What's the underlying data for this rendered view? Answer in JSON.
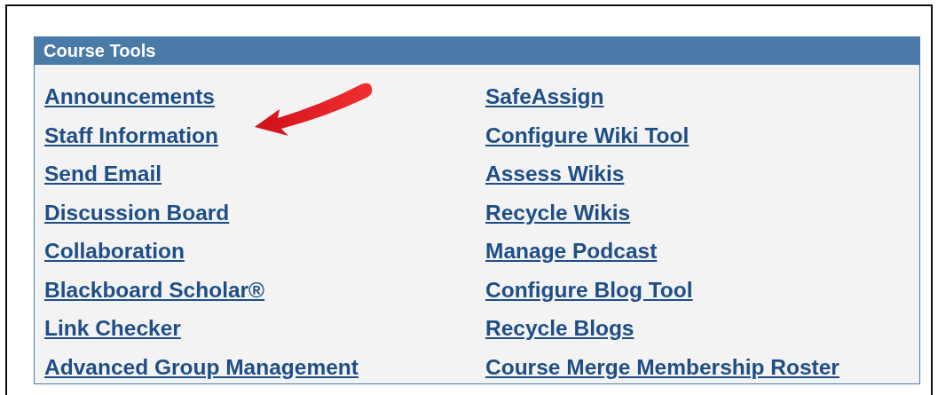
{
  "panel": {
    "title": "Course Tools"
  },
  "columns": [
    [
      "Announcements",
      "Staff Information",
      "Send Email",
      "Discussion Board",
      "Collaboration",
      "Blackboard Scholar®",
      "Link Checker",
      "Advanced Group Management"
    ],
    [
      "SafeAssign",
      "Configure Wiki Tool",
      "Assess Wikis",
      "Recycle Wikis",
      "Manage Podcast",
      "Configure Blog Tool",
      "Recycle Blogs",
      "Course Merge Membership Roster"
    ]
  ]
}
